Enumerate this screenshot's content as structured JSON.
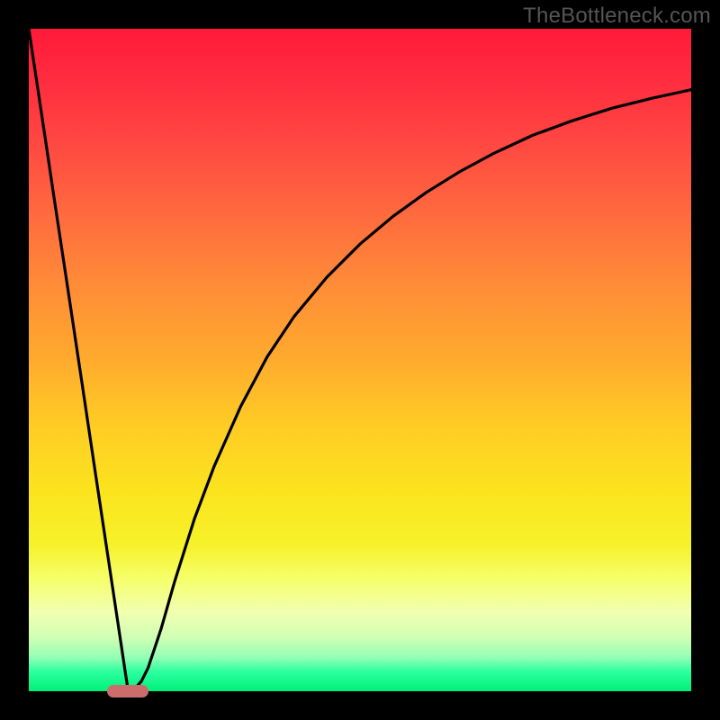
{
  "watermark": "TheBottleneck.com",
  "colors": {
    "page_bg": "#000000",
    "curve_stroke": "#000000",
    "marker_fill": "#cc6d6d"
  },
  "chart_data": {
    "type": "line",
    "title": "",
    "xlabel": "",
    "ylabel": "",
    "xlim": [
      0,
      100
    ],
    "ylim": [
      0,
      100
    ],
    "x": [
      0,
      2,
      4,
      6,
      8,
      10,
      12,
      14,
      15,
      16,
      17,
      18,
      20,
      22,
      25,
      28,
      32,
      36,
      40,
      45,
      50,
      55,
      60,
      65,
      70,
      76,
      82,
      88,
      94,
      100
    ],
    "values": [
      100,
      86.7,
      73.3,
      60.0,
      46.7,
      33.3,
      20.0,
      6.7,
      0.0,
      0.4,
      1.5,
      3.5,
      9.5,
      16.5,
      26.0,
      34.0,
      43.0,
      50.5,
      56.5,
      62.5,
      67.5,
      71.7,
      75.3,
      78.4,
      81.1,
      83.9,
      86.1,
      88.0,
      89.5,
      90.8
    ],
    "marker": {
      "x": 15,
      "y": 0
    },
    "gradient_stops": [
      {
        "pos": 0.0,
        "color": "#ff1a3a"
      },
      {
        "pos": 0.5,
        "color": "#ffab2e"
      },
      {
        "pos": 0.78,
        "color": "#f6f22a"
      },
      {
        "pos": 1.0,
        "color": "#00f17a"
      }
    ]
  }
}
